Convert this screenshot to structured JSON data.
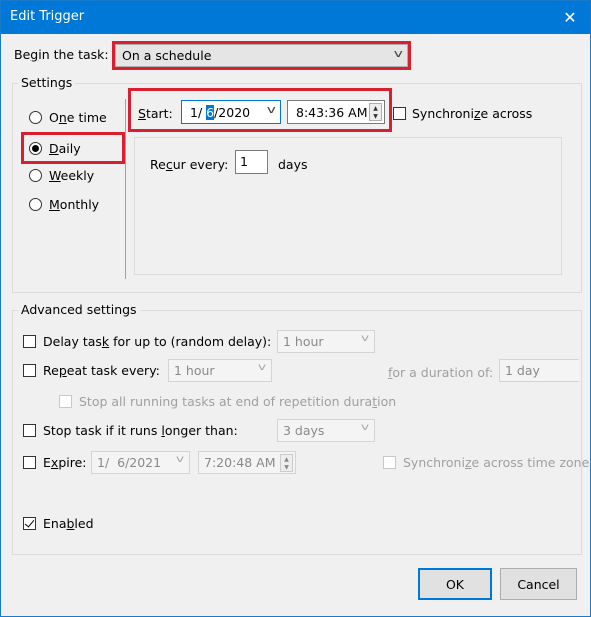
{
  "window": {
    "title": "Edit Trigger",
    "close_icon": "close-icon"
  },
  "begin_task": {
    "label_pre": "Be",
    "label_u": "g",
    "label_post": "in the task:",
    "value": "On a schedule"
  },
  "settings": {
    "group_label": "Settings",
    "schedule_options": [
      {
        "pre": "O",
        "u": "n",
        "post": "e time",
        "selected": false
      },
      {
        "pre": "",
        "u": "D",
        "post": "aily",
        "selected": true
      },
      {
        "pre": "",
        "u": "W",
        "post": "eekly",
        "selected": false
      },
      {
        "pre": "",
        "u": "M",
        "post": "onthly",
        "selected": false
      }
    ],
    "start": {
      "label_u": "S",
      "label_post": "tart:",
      "date_pre": "1/ ",
      "date_sel": "6",
      "date_post": "/2020",
      "time": "8:43:36 AM",
      "sync_pre": "Synchroni",
      "sync_u": "z",
      "sync_post": "e across",
      "sync_checked": false
    },
    "recur": {
      "label_pre": "Re",
      "label_u": "c",
      "label_post": "ur every:",
      "value": "1",
      "unit": "days"
    }
  },
  "advanced": {
    "group_label": "Advanced settings",
    "delay": {
      "label_pre": "Delay tas",
      "label_u": "k",
      "label_post": " for up to (random delay):",
      "checked": false,
      "value": "1 hour"
    },
    "repeat": {
      "label_pre": "Re",
      "label_u": "p",
      "label_post": "eat task every:",
      "checked": false,
      "value": "1 hour",
      "duration_pre": "",
      "duration_u": "f",
      "duration_post": "or a duration of:",
      "duration_value": "1 day"
    },
    "stop_all": {
      "label_pre": "Stop all running tasks at end of repetition dura",
      "label_u": "t",
      "label_post": "ion",
      "checked": false
    },
    "stop_longer": {
      "label_pre": "Stop task if it runs ",
      "label_u": "l",
      "label_post": "onger than:",
      "checked": false,
      "value": "3 days"
    },
    "expire": {
      "label_pre": "E",
      "label_u": "x",
      "label_post": "pire:",
      "checked": false,
      "date": "1/  6/2021",
      "time": "7:20:48 AM",
      "sync_pre": "Synchroni",
      "sync_u": "z",
      "sync_post": "e across time zone",
      "sync_checked": false
    },
    "enabled": {
      "label_pre": "Ena",
      "label_u": "b",
      "label_post": "led",
      "checked": true
    }
  },
  "buttons": {
    "ok": "OK",
    "cancel": "Cancel"
  },
  "colors": {
    "titlebar": "#0078d7",
    "highlight": "#d92030"
  }
}
